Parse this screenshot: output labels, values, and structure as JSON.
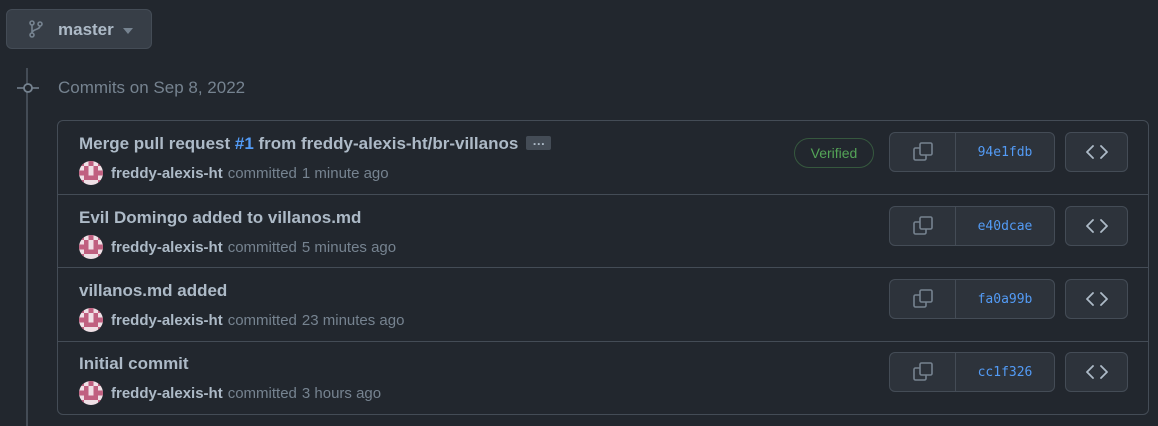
{
  "branch": {
    "name": "master",
    "icon": "git-branch-icon"
  },
  "day_group": {
    "heading": "Commits on Sep 8, 2022"
  },
  "commits": [
    {
      "title_prefix": "Merge pull request ",
      "pr_link": "#1",
      "title_suffix": " from freddy-alexis-ht/br-villanos",
      "ellipsis": "…",
      "author": "freddy-alexis-ht",
      "committed": "committed",
      "time": "1 minute ago",
      "verified": "Verified",
      "sha": "94e1fdb"
    },
    {
      "title": "Evil Domingo added to villanos.md",
      "author": "freddy-alexis-ht",
      "committed": "committed",
      "time": "5 minutes ago",
      "sha": "e40dcae"
    },
    {
      "title": "villanos.md added",
      "author": "freddy-alexis-ht",
      "committed": "committed",
      "time": "23 minutes ago",
      "sha": "fa0a99b"
    },
    {
      "title": "Initial commit",
      "author": "freddy-alexis-ht",
      "committed": "committed",
      "time": "3 hours ago",
      "sha": "cc1f326"
    }
  ],
  "colors": {
    "background": "#22272e",
    "border": "#444c56",
    "link": "#539bf5",
    "verified": "#57ab5a",
    "text": "#adbac7",
    "muted": "#768390"
  }
}
